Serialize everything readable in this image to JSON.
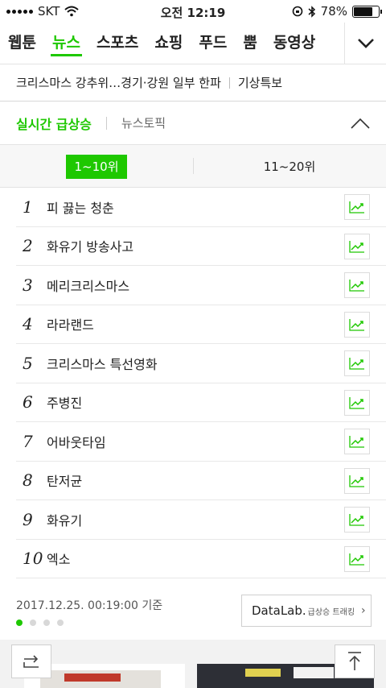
{
  "status_bar": {
    "carrier": "SKT",
    "time": "오전 12:19",
    "battery": "78%",
    "battery_level": 0.78
  },
  "nav": {
    "tabs": [
      {
        "label": "웹툰",
        "active": false
      },
      {
        "label": "뉴스",
        "active": true
      },
      {
        "label": "스포츠",
        "active": false
      },
      {
        "label": "쇼핑",
        "active": false
      },
      {
        "label": "푸드",
        "active": false
      },
      {
        "label": "뿜",
        "active": false
      },
      {
        "label": "동영상",
        "active": false
      }
    ],
    "more_icon": "chevron-down-icon"
  },
  "headline": {
    "items": [
      "크리스마스 강추위…경기·강원 일부 한파",
      "기상특보"
    ]
  },
  "section": {
    "active_label": "실시간 급상승",
    "other_label": "뉴스토픽"
  },
  "range_tabs": {
    "first": "1~10위",
    "second": "11~20위"
  },
  "ranking": [
    {
      "rank": "1",
      "keyword": "피 끓는 청춘"
    },
    {
      "rank": "2",
      "keyword": "화유기 방송사고"
    },
    {
      "rank": "3",
      "keyword": "메리크리스마스"
    },
    {
      "rank": "4",
      "keyword": "라라랜드"
    },
    {
      "rank": "5",
      "keyword": "크리스마스 특선영화"
    },
    {
      "rank": "6",
      "keyword": "주병진"
    },
    {
      "rank": "7",
      "keyword": "어바웃타임"
    },
    {
      "rank": "8",
      "keyword": "탄저균"
    },
    {
      "rank": "9",
      "keyword": "화유기"
    },
    {
      "rank": "10",
      "keyword": "엑소"
    }
  ],
  "footer": {
    "timestamp": "2017.12.25. 00:19:00 기준",
    "datalab_main": "DataLab.",
    "datalab_sub": "급상승 트래킹",
    "page_count": 4,
    "page_active": 1
  },
  "colors": {
    "accent": "#1ec800"
  }
}
